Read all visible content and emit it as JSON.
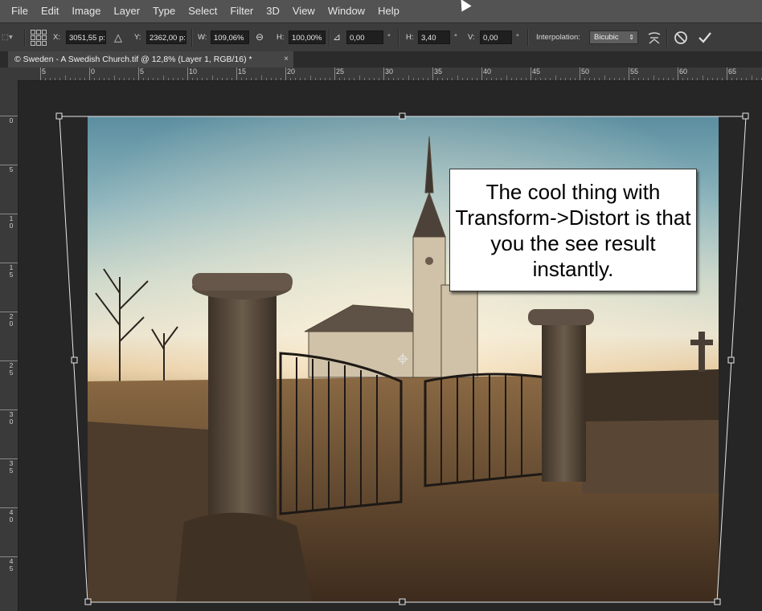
{
  "menu": [
    "File",
    "Edit",
    "Image",
    "Layer",
    "Type",
    "Select",
    "Filter",
    "3D",
    "View",
    "Window",
    "Help"
  ],
  "options": {
    "x_label": "X:",
    "x_value": "3051,55 p:",
    "y_label": "Y:",
    "y_value": "2362,00 p:",
    "w_label": "W:",
    "w_value": "109,06%",
    "h_label": "H:",
    "h_value": "100,00%",
    "angle_value": "0,00",
    "angle_unit": "°",
    "hskew_label": "H:",
    "hskew_value": "3,40",
    "hskew_unit": "°",
    "vskew_label": "V:",
    "vskew_value": "0,00",
    "vskew_unit": "°",
    "interp_label": "Interpolation:",
    "interp_value": "Bicubic"
  },
  "tab": {
    "title": "© Sweden - A Swedish Church.tif @ 12,8% (Layer 1, RGB/16) *",
    "close": "×"
  },
  "ruler_h": [
    "5",
    "0",
    "5",
    "10",
    "15",
    "20",
    "25",
    "30",
    "35",
    "40",
    "45",
    "50",
    "55",
    "60",
    "65"
  ],
  "ruler_v": [
    [
      "0"
    ],
    [
      "5"
    ],
    [
      "1",
      "0"
    ],
    [
      "1",
      "5"
    ],
    [
      "2",
      "0"
    ],
    [
      "2",
      "5"
    ],
    [
      "3",
      "0"
    ],
    [
      "3",
      "5"
    ],
    [
      "4",
      "0"
    ],
    [
      "4",
      "5"
    ]
  ],
  "callout": {
    "text": "The cool thing with Transform->Distort is that you the see result instantly."
  },
  "colors": {
    "menubar": "#535353",
    "optionsbar": "#3c3c3c",
    "canvas": "#262626"
  }
}
